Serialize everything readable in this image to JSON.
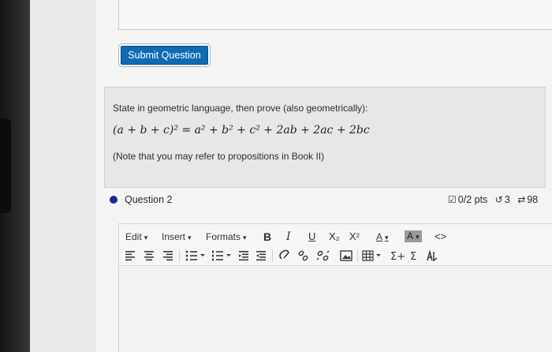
{
  "submit_button": {
    "label": "Submit Question"
  },
  "question1": {
    "prompt": "State in geometric language, then prove (also geometrically):",
    "formula": "(a + b + c)² = a² + b² + c² + 2ab + 2ac + 2bc",
    "note": "(Note that you may refer to propositions in Book II)"
  },
  "question2": {
    "title": "Question 2",
    "points": "0/2 pts",
    "retries": "3",
    "attempts": "98",
    "colors": {
      "indicator": "#1b2a8c"
    }
  },
  "editor": {
    "menus": {
      "edit": "Edit",
      "insert": "Insert",
      "formats": "Formats"
    },
    "format_buttons": {
      "bold": "B",
      "italic": "I",
      "underline": "U",
      "subscript": "X₂",
      "superscript": "X²",
      "text_color": "A",
      "background_color": "A",
      "source_code": "<>"
    },
    "icons": [
      "align-left-icon",
      "align-center-icon",
      "align-right-icon",
      "bullet-list-icon",
      "numbered-list-icon",
      "outdent-icon",
      "indent-icon",
      "link-icon",
      "unlink-icon",
      "broken-link-icon",
      "image-icon",
      "table-icon",
      "insert-equation-icon",
      "sigma-icon",
      "accessibility-icon"
    ]
  },
  "colors": {
    "button_blue": "#0f6bb3",
    "question_box_bg": "#e6e7e6"
  }
}
